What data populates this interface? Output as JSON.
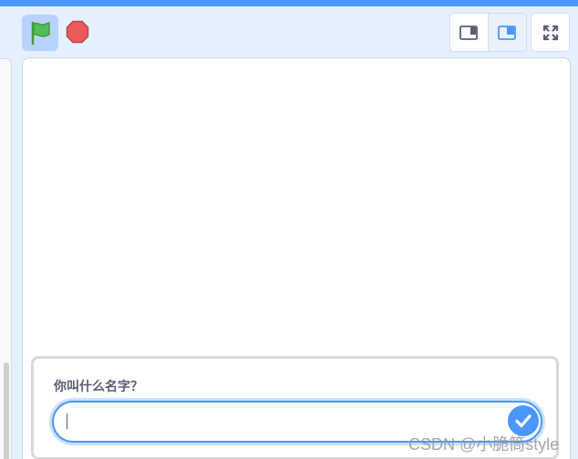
{
  "controls": {
    "green_flag_icon": "green-flag-icon",
    "stop_icon": "stop-sign-icon",
    "small_stage_icon": "small-stage-layout-icon",
    "large_stage_icon": "large-stage-layout-icon",
    "fullscreen_icon": "fullscreen-icon"
  },
  "ask_prompt": {
    "question": "你叫什么名字？",
    "input_value": "",
    "submit_icon": "check-icon"
  },
  "watermark": "CSDN @小脆筒style",
  "colors": {
    "accent": "#4c97ff",
    "background": "#e5f0ff",
    "stop_red": "#ec5959",
    "flag_green": "#4cbf56"
  }
}
